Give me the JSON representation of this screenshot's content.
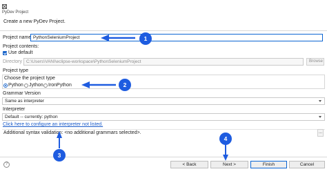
{
  "window": {
    "title": "PyDev Project"
  },
  "header": {
    "text": "Create a new PyDev Project."
  },
  "project_name": {
    "label": "Project name:",
    "value": "PythonSeleniumProject"
  },
  "contents": {
    "label": "Project contents:",
    "use_default_label": "Use default",
    "use_default_checked": true,
    "directory_label": "Directory",
    "directory_value": "C:\\Users\\VANI\\eclipse-workspace\\PythonSeleniumProject",
    "browse_label": "Browse"
  },
  "project_type": {
    "label": "Project type",
    "group_label": "Choose the project type",
    "options": [
      "Python",
      "Jython",
      "IronPython"
    ],
    "selected": "Python"
  },
  "grammar": {
    "label": "Grammar Version",
    "value": "Same as interpreter"
  },
  "interpreter": {
    "label": "Interpreter",
    "value": "Default  -- currently: python",
    "configure_link": "Click here to configure an interpreter not listed."
  },
  "syntax": {
    "text": "Additional syntax validation: <no additional grammars selected>.",
    "button": "..."
  },
  "buttons": {
    "back": "< Back",
    "next": "Next >",
    "finish": "Finish",
    "cancel": "Cancel"
  },
  "callouts": {
    "1": "1",
    "2": "2",
    "3": "3",
    "4": "4",
    "color": "#1e5ce0"
  },
  "help_icon": "?"
}
